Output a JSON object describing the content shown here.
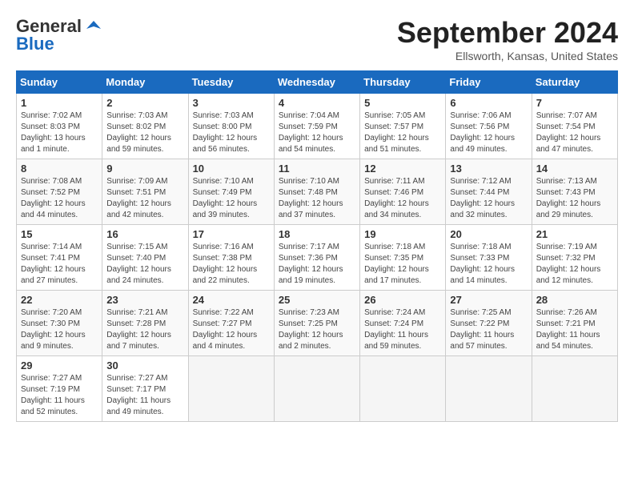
{
  "header": {
    "logo_line1": "General",
    "logo_line2": "Blue",
    "month": "September 2024",
    "location": "Ellsworth, Kansas, United States"
  },
  "weekdays": [
    "Sunday",
    "Monday",
    "Tuesday",
    "Wednesday",
    "Thursday",
    "Friday",
    "Saturday"
  ],
  "weeks": [
    [
      {
        "day": "1",
        "sunrise": "7:02 AM",
        "sunset": "8:03 PM",
        "daylight": "13 hours and 1 minute."
      },
      {
        "day": "2",
        "sunrise": "7:03 AM",
        "sunset": "8:02 PM",
        "daylight": "12 hours and 59 minutes."
      },
      {
        "day": "3",
        "sunrise": "7:03 AM",
        "sunset": "8:00 PM",
        "daylight": "12 hours and 56 minutes."
      },
      {
        "day": "4",
        "sunrise": "7:04 AM",
        "sunset": "7:59 PM",
        "daylight": "12 hours and 54 minutes."
      },
      {
        "day": "5",
        "sunrise": "7:05 AM",
        "sunset": "7:57 PM",
        "daylight": "12 hours and 51 minutes."
      },
      {
        "day": "6",
        "sunrise": "7:06 AM",
        "sunset": "7:56 PM",
        "daylight": "12 hours and 49 minutes."
      },
      {
        "day": "7",
        "sunrise": "7:07 AM",
        "sunset": "7:54 PM",
        "daylight": "12 hours and 47 minutes."
      }
    ],
    [
      {
        "day": "8",
        "sunrise": "7:08 AM",
        "sunset": "7:52 PM",
        "daylight": "12 hours and 44 minutes."
      },
      {
        "day": "9",
        "sunrise": "7:09 AM",
        "sunset": "7:51 PM",
        "daylight": "12 hours and 42 minutes."
      },
      {
        "day": "10",
        "sunrise": "7:10 AM",
        "sunset": "7:49 PM",
        "daylight": "12 hours and 39 minutes."
      },
      {
        "day": "11",
        "sunrise": "7:10 AM",
        "sunset": "7:48 PM",
        "daylight": "12 hours and 37 minutes."
      },
      {
        "day": "12",
        "sunrise": "7:11 AM",
        "sunset": "7:46 PM",
        "daylight": "12 hours and 34 minutes."
      },
      {
        "day": "13",
        "sunrise": "7:12 AM",
        "sunset": "7:44 PM",
        "daylight": "12 hours and 32 minutes."
      },
      {
        "day": "14",
        "sunrise": "7:13 AM",
        "sunset": "7:43 PM",
        "daylight": "12 hours and 29 minutes."
      }
    ],
    [
      {
        "day": "15",
        "sunrise": "7:14 AM",
        "sunset": "7:41 PM",
        "daylight": "12 hours and 27 minutes."
      },
      {
        "day": "16",
        "sunrise": "7:15 AM",
        "sunset": "7:40 PM",
        "daylight": "12 hours and 24 minutes."
      },
      {
        "day": "17",
        "sunrise": "7:16 AM",
        "sunset": "7:38 PM",
        "daylight": "12 hours and 22 minutes."
      },
      {
        "day": "18",
        "sunrise": "7:17 AM",
        "sunset": "7:36 PM",
        "daylight": "12 hours and 19 minutes."
      },
      {
        "day": "19",
        "sunrise": "7:18 AM",
        "sunset": "7:35 PM",
        "daylight": "12 hours and 17 minutes."
      },
      {
        "day": "20",
        "sunrise": "7:18 AM",
        "sunset": "7:33 PM",
        "daylight": "12 hours and 14 minutes."
      },
      {
        "day": "21",
        "sunrise": "7:19 AM",
        "sunset": "7:32 PM",
        "daylight": "12 hours and 12 minutes."
      }
    ],
    [
      {
        "day": "22",
        "sunrise": "7:20 AM",
        "sunset": "7:30 PM",
        "daylight": "12 hours and 9 minutes."
      },
      {
        "day": "23",
        "sunrise": "7:21 AM",
        "sunset": "7:28 PM",
        "daylight": "12 hours and 7 minutes."
      },
      {
        "day": "24",
        "sunrise": "7:22 AM",
        "sunset": "7:27 PM",
        "daylight": "12 hours and 4 minutes."
      },
      {
        "day": "25",
        "sunrise": "7:23 AM",
        "sunset": "7:25 PM",
        "daylight": "12 hours and 2 minutes."
      },
      {
        "day": "26",
        "sunrise": "7:24 AM",
        "sunset": "7:24 PM",
        "daylight": "11 hours and 59 minutes."
      },
      {
        "day": "27",
        "sunrise": "7:25 AM",
        "sunset": "7:22 PM",
        "daylight": "11 hours and 57 minutes."
      },
      {
        "day": "28",
        "sunrise": "7:26 AM",
        "sunset": "7:21 PM",
        "daylight": "11 hours and 54 minutes."
      }
    ],
    [
      {
        "day": "29",
        "sunrise": "7:27 AM",
        "sunset": "7:19 PM",
        "daylight": "11 hours and 52 minutes."
      },
      {
        "day": "30",
        "sunrise": "7:27 AM",
        "sunset": "7:17 PM",
        "daylight": "11 hours and 49 minutes."
      },
      null,
      null,
      null,
      null,
      null
    ]
  ]
}
